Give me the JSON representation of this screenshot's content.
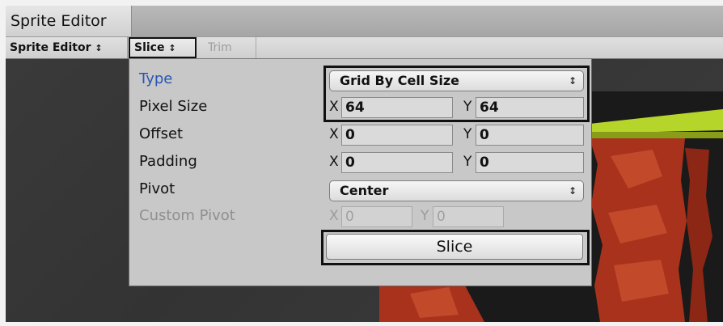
{
  "window": {
    "title": "Sprite Editor"
  },
  "toolbar": {
    "mode_label": "Sprite Editor",
    "slice_label": "Slice",
    "trim_label": "Trim",
    "caret": "↕"
  },
  "slice_panel": {
    "type": {
      "label": "Type",
      "value": "Grid By Cell Size"
    },
    "pixel_size": {
      "label": "Pixel Size",
      "x": "64",
      "y": "64"
    },
    "offset": {
      "label": "Offset",
      "x": "0",
      "y": "0"
    },
    "padding": {
      "label": "Padding",
      "x": "0",
      "y": "0"
    },
    "pivot": {
      "label": "Pivot",
      "value": "Center"
    },
    "custom_pivot": {
      "label": "Custom Pivot",
      "x": "0",
      "y": "0"
    },
    "axis_x": "X",
    "axis_y": "Y",
    "slice_button": "Slice"
  },
  "colors": {
    "active_label": "#2855b5",
    "canvas_bg": "#333333",
    "panel_bg": "#c8c8c8",
    "grass": "#b5d52a",
    "rock": "#a8321c"
  }
}
